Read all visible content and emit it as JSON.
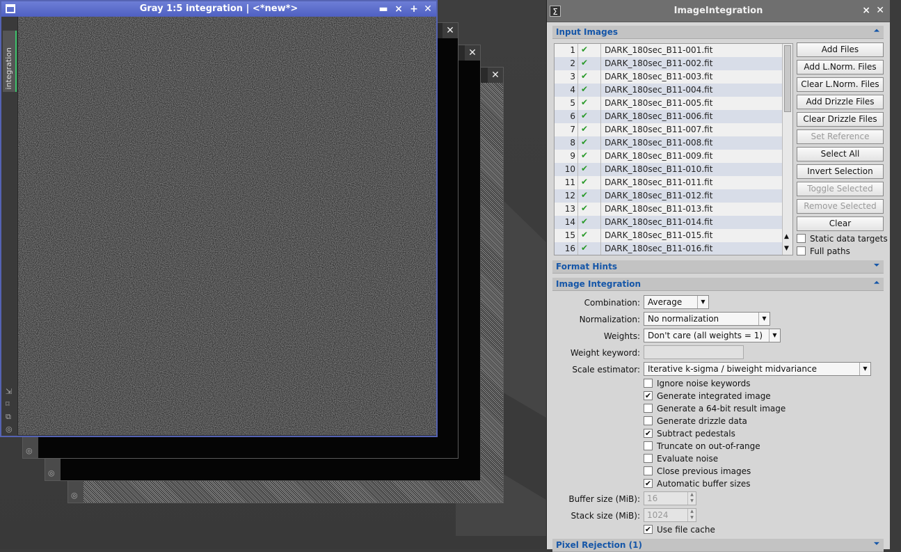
{
  "image_window": {
    "title": "Gray 1:5 integration | <*new*>",
    "side_tab_label": "integration"
  },
  "process_panel": {
    "title": "ImageIntegration",
    "sections": {
      "input_images": "Input Images",
      "format_hints": "Format Hints",
      "image_integration": "Image Integration",
      "pixel_rejection": "Pixel Rejection (1)"
    },
    "files": [
      {
        "n": "1",
        "name": "DARK_180sec_B11-001.fit"
      },
      {
        "n": "2",
        "name": "DARK_180sec_B11-002.fit"
      },
      {
        "n": "3",
        "name": "DARK_180sec_B11-003.fit"
      },
      {
        "n": "4",
        "name": "DARK_180sec_B11-004.fit"
      },
      {
        "n": "5",
        "name": "DARK_180sec_B11-005.fit"
      },
      {
        "n": "6",
        "name": "DARK_180sec_B11-006.fit"
      },
      {
        "n": "7",
        "name": "DARK_180sec_B11-007.fit"
      },
      {
        "n": "8",
        "name": "DARK_180sec_B11-008.fit"
      },
      {
        "n": "9",
        "name": "DARK_180sec_B11-009.fit"
      },
      {
        "n": "10",
        "name": "DARK_180sec_B11-010.fit"
      },
      {
        "n": "11",
        "name": "DARK_180sec_B11-011.fit"
      },
      {
        "n": "12",
        "name": "DARK_180sec_B11-012.fit"
      },
      {
        "n": "13",
        "name": "DARK_180sec_B11-013.fit"
      },
      {
        "n": "14",
        "name": "DARK_180sec_B11-014.fit"
      },
      {
        "n": "15",
        "name": "DARK_180sec_B11-015.fit"
      },
      {
        "n": "16",
        "name": "DARK_180sec_B11-016.fit"
      }
    ],
    "buttons": [
      {
        "label": "Add Files",
        "enabled": true
      },
      {
        "label": "Add L.Norm. Files",
        "enabled": true
      },
      {
        "label": "Clear L.Norm. Files",
        "enabled": true
      },
      {
        "label": "Add Drizzle Files",
        "enabled": true
      },
      {
        "label": "Clear Drizzle Files",
        "enabled": true
      },
      {
        "label": "Set Reference",
        "enabled": false
      },
      {
        "label": "Select All",
        "enabled": true
      },
      {
        "label": "Invert Selection",
        "enabled": true
      },
      {
        "label": "Toggle Selected",
        "enabled": false
      },
      {
        "label": "Remove Selected",
        "enabled": false
      },
      {
        "label": "Clear",
        "enabled": true
      }
    ],
    "list_options": {
      "static_data_targets": {
        "label": "Static data targets",
        "checked": false
      },
      "full_paths": {
        "label": "Full paths",
        "checked": false
      }
    },
    "integration": {
      "combination": {
        "label": "Combination:",
        "value": "Average"
      },
      "normalization": {
        "label": "Normalization:",
        "value": "No normalization"
      },
      "weights": {
        "label": "Weights:",
        "value": "Don't care (all weights = 1)"
      },
      "weight_keyword": {
        "label": "Weight keyword:",
        "value": ""
      },
      "scale_estimator": {
        "label": "Scale estimator:",
        "value": "Iterative k-sigma / biweight midvariance"
      },
      "checks": [
        {
          "label": "Ignore noise keywords",
          "checked": false
        },
        {
          "label": "Generate integrated image",
          "checked": true
        },
        {
          "label": "Generate a 64-bit result image",
          "checked": false
        },
        {
          "label": "Generate drizzle data",
          "checked": false
        },
        {
          "label": "Subtract pedestals",
          "checked": true
        },
        {
          "label": "Truncate on out-of-range",
          "checked": false
        },
        {
          "label": "Evaluate noise",
          "checked": false
        },
        {
          "label": "Close previous images",
          "checked": false
        },
        {
          "label": "Automatic buffer sizes",
          "checked": true
        }
      ],
      "buffer_size": {
        "label": "Buffer size (MiB):",
        "value": "16"
      },
      "stack_size": {
        "label": "Stack size (MiB):",
        "value": "1024"
      },
      "use_file_cache": {
        "label": "Use file cache",
        "checked": true
      }
    }
  },
  "icons": {
    "check": "✔",
    "close": "✕",
    "minimize": "▬",
    "shade": "⨯",
    "maximize": "+",
    "collapse": "⏶",
    "expand": "⏷",
    "sigma": "Σ"
  }
}
